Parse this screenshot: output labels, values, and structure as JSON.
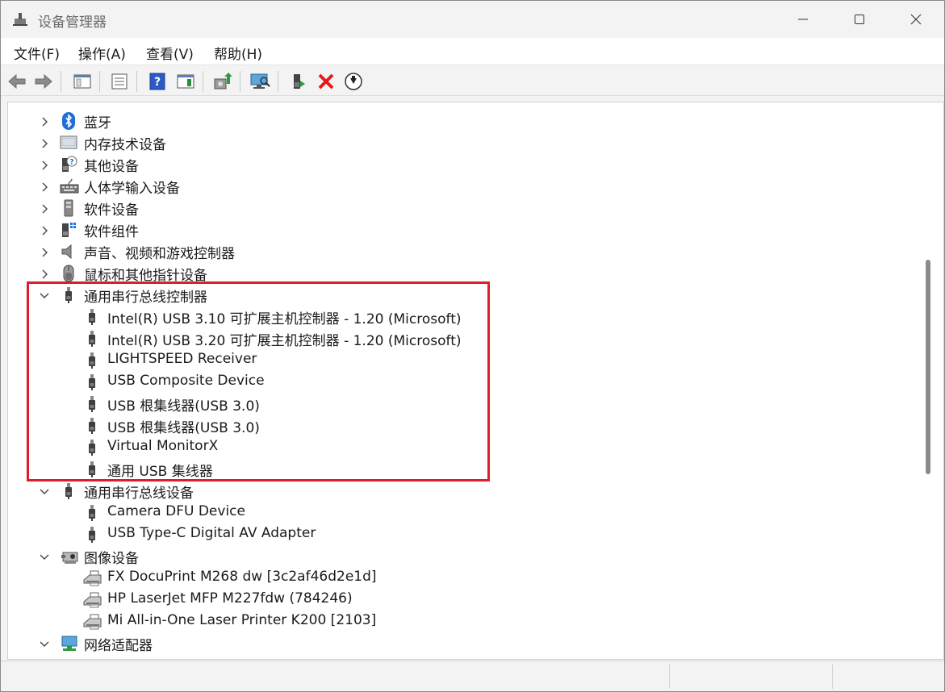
{
  "window": {
    "title": "设备管理器"
  },
  "menu": [
    "文件(F)",
    "操作(A)",
    "查看(V)",
    "帮助(H)"
  ],
  "colors": {
    "highlight": "#e01b2e",
    "accent": "#1e6fd9",
    "delete": "#e21b1b"
  },
  "toolbar": [
    {
      "icon": "back-arrow-icon"
    },
    {
      "icon": "forward-arrow-icon"
    },
    {
      "icon": "show-hide-console-tree-icon"
    },
    {
      "icon": "properties-icon"
    },
    {
      "icon": "help-icon"
    },
    {
      "icon": "action-pane-icon"
    },
    {
      "icon": "update-driver-icon"
    },
    {
      "icon": "scan-hardware-icon"
    },
    {
      "icon": "enable-device-icon"
    },
    {
      "icon": "uninstall-device-icon"
    },
    {
      "icon": "disable-device-icon"
    }
  ],
  "tree": [
    {
      "kind": "category",
      "expanded": false,
      "icon": "bluetooth-icon",
      "label": "蓝牙"
    },
    {
      "kind": "category",
      "expanded": false,
      "icon": "memory-device-icon",
      "label": "内存技术设备"
    },
    {
      "kind": "category",
      "expanded": false,
      "icon": "other-device-icon",
      "label": "其他设备"
    },
    {
      "kind": "category",
      "expanded": false,
      "icon": "hid-device-icon",
      "label": "人体学输入设备"
    },
    {
      "kind": "category",
      "expanded": false,
      "icon": "software-device-icon",
      "label": "软件设备"
    },
    {
      "kind": "category",
      "expanded": false,
      "icon": "software-component-icon",
      "label": "软件组件"
    },
    {
      "kind": "category",
      "expanded": false,
      "icon": "audio-device-icon",
      "label": "声音、视频和游戏控制器"
    },
    {
      "kind": "category",
      "expanded": false,
      "icon": "mouse-icon",
      "label": "鼠标和其他指针设备"
    },
    {
      "kind": "category",
      "expanded": true,
      "icon": "usb-icon",
      "label": "通用串行总线控制器"
    },
    {
      "kind": "device",
      "icon": "usb-icon",
      "label": "Intel(R) USB 3.10 可扩展主机控制器 - 1.20 (Microsoft)"
    },
    {
      "kind": "device",
      "icon": "usb-icon",
      "label": "Intel(R) USB 3.20 可扩展主机控制器 - 1.20 (Microsoft)"
    },
    {
      "kind": "device",
      "icon": "usb-icon",
      "label": "LIGHTSPEED Receiver"
    },
    {
      "kind": "device",
      "icon": "usb-icon",
      "label": "USB Composite Device"
    },
    {
      "kind": "device",
      "icon": "usb-icon",
      "label": "USB 根集线器(USB 3.0)"
    },
    {
      "kind": "device",
      "icon": "usb-icon",
      "label": "USB 根集线器(USB 3.0)"
    },
    {
      "kind": "device",
      "icon": "usb-icon",
      "label": "Virtual MonitorX"
    },
    {
      "kind": "device",
      "icon": "usb-icon",
      "label": "通用 USB 集线器"
    },
    {
      "kind": "category",
      "expanded": true,
      "icon": "usb-icon",
      "label": "通用串行总线设备"
    },
    {
      "kind": "device",
      "icon": "usb-icon",
      "label": "Camera DFU Device"
    },
    {
      "kind": "device",
      "icon": "usb-icon",
      "label": "USB Type-C Digital AV Adapter"
    },
    {
      "kind": "category",
      "expanded": true,
      "icon": "imaging-device-icon",
      "label": "图像设备"
    },
    {
      "kind": "device",
      "icon": "printer-icon",
      "label": "FX DocuPrint M268 dw [3c2af46d2e1d]"
    },
    {
      "kind": "device",
      "icon": "printer-icon",
      "label": "HP LaserJet MFP M227fdw (784246)"
    },
    {
      "kind": "device",
      "icon": "printer-icon",
      "label": "Mi All-in-One Laser Printer K200 [2103]"
    },
    {
      "kind": "category",
      "expanded": true,
      "icon": "network-adapter-icon",
      "label": "网络适配器"
    }
  ]
}
